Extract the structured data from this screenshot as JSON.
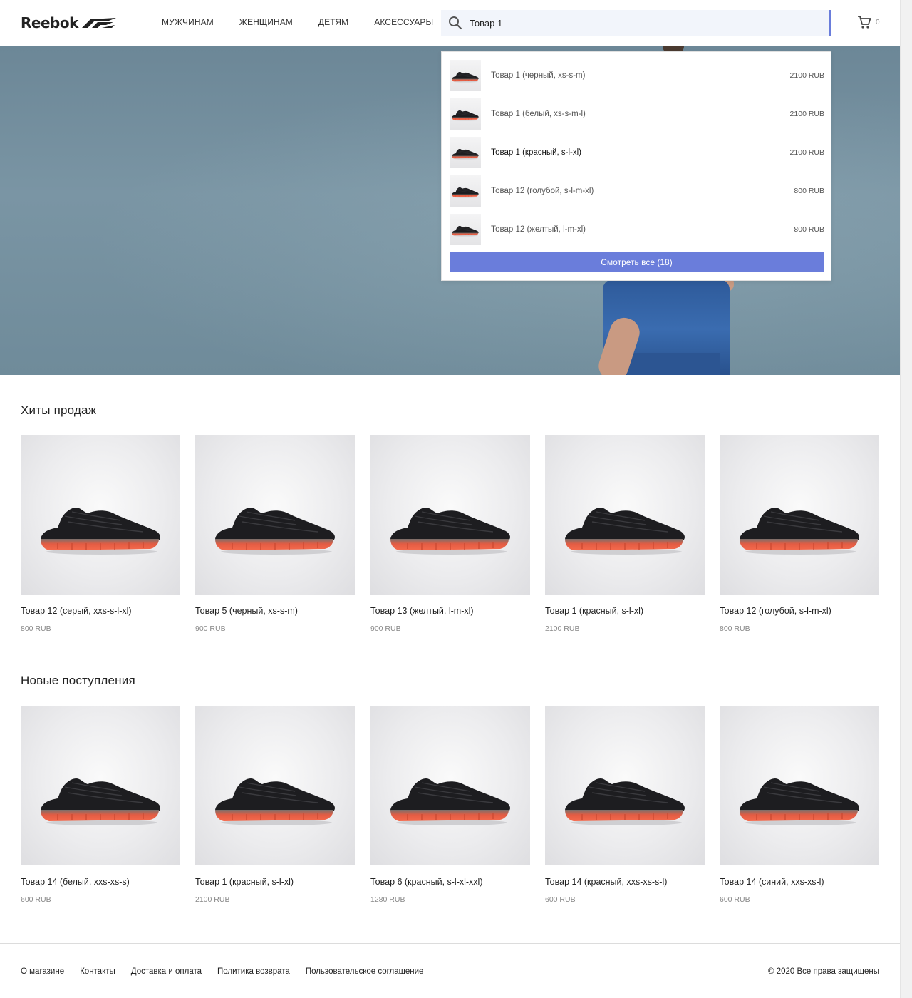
{
  "header": {
    "logo": "Reebok",
    "nav": [
      "МУЖЧИНАМ",
      "ЖЕНЩИНАМ",
      "ДЕТЯМ",
      "АКСЕССУАРЫ"
    ],
    "search_value": "Товар 1",
    "cart_count": "0"
  },
  "dropdown": {
    "items": [
      {
        "name": "Товар 1 (черный, xs-s-m)",
        "price": "2100 RUB"
      },
      {
        "name": "Товар 1 (белый, xs-s-m-l)",
        "price": "2100 RUB"
      },
      {
        "name": "Товар 1 (красный, s-l-xl)",
        "price": "2100 RUB"
      },
      {
        "name": "Товар 12 (голубой, s-l-m-xl)",
        "price": "800 RUB"
      },
      {
        "name": "Товар 12 (желтый, l-m-xl)",
        "price": "800 RUB"
      }
    ],
    "see_all": "Смотреть все (18)"
  },
  "bestsellers": {
    "title": "Хиты продаж",
    "items": [
      {
        "name": "Товар 12 (серый, xxs-s-l-xl)",
        "price": "800 RUB"
      },
      {
        "name": "Товар 5 (черный, xs-s-m)",
        "price": "900 RUB"
      },
      {
        "name": "Товар 13 (желтый, l-m-xl)",
        "price": "900 RUB"
      },
      {
        "name": "Товар 1 (красный, s-l-xl)",
        "price": "2100 RUB"
      },
      {
        "name": "Товар 12 (голубой, s-l-m-xl)",
        "price": "800 RUB"
      }
    ]
  },
  "new_arrivals": {
    "title": "Новые поступления",
    "items": [
      {
        "name": "Товар 14 (белый, xxs-xs-s)",
        "price": "600 RUB"
      },
      {
        "name": "Товар 1 (красный, s-l-xl)",
        "price": "2100 RUB"
      },
      {
        "name": "Товар 6 (красный, s-l-xl-xxl)",
        "price": "1280 RUB"
      },
      {
        "name": "Товар 14 (красный, xxs-xs-s-l)",
        "price": "600 RUB"
      },
      {
        "name": "Товар 14 (синий, xxs-xs-l)",
        "price": "600 RUB"
      }
    ]
  },
  "footer": {
    "links": [
      "О магазине",
      "Контакты",
      "Доставка и оплата",
      "Политика возврата",
      "Пользовательское соглашение"
    ],
    "copyright": "© 2020 Все права защищены"
  },
  "colors": {
    "accent": "#6a7ddb",
    "search_bg": "#f2f5fb",
    "shoe_sole": "#f0654a"
  },
  "icons": [
    "search-icon",
    "cart-icon",
    "reebok-delta-logo"
  ]
}
